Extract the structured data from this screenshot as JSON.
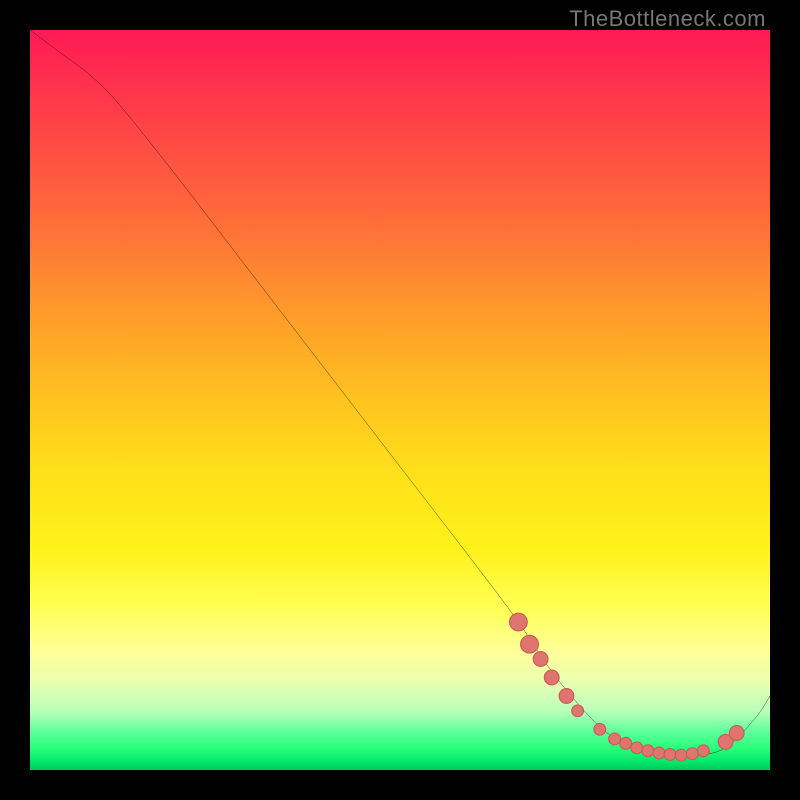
{
  "watermark": "TheBottleneck.com",
  "colors": {
    "page_bg": "#000000",
    "curve": "#000000",
    "dot_fill": "#e0746e",
    "dot_stroke": "#c75b55"
  },
  "chart_data": {
    "type": "line",
    "title": "",
    "xlabel": "",
    "ylabel": "",
    "xlim": [
      0,
      100
    ],
    "ylim": [
      0,
      100
    ],
    "grid": false,
    "legend": false,
    "annotations": [
      "TheBottleneck.com"
    ],
    "series": [
      {
        "name": "curve",
        "x": [
          0,
          4,
          8,
          12,
          20,
          30,
          40,
          50,
          60,
          66,
          70,
          74,
          78,
          82,
          86,
          90,
          94,
          98,
          100
        ],
        "y": [
          100,
          97,
          94,
          90,
          80,
          67,
          54,
          41,
          28,
          20,
          14,
          9,
          5,
          3,
          2,
          2,
          3,
          7,
          10
        ]
      }
    ],
    "markers": [
      {
        "x": 66,
        "y": 20,
        "r": 1.2
      },
      {
        "x": 67.5,
        "y": 17,
        "r": 1.2
      },
      {
        "x": 69,
        "y": 15,
        "r": 1.0
      },
      {
        "x": 70.5,
        "y": 12.5,
        "r": 1.0
      },
      {
        "x": 72.5,
        "y": 10,
        "r": 1.0
      },
      {
        "x": 74,
        "y": 8,
        "r": 0.8
      },
      {
        "x": 77,
        "y": 5.5,
        "r": 0.8
      },
      {
        "x": 79,
        "y": 4.2,
        "r": 0.8
      },
      {
        "x": 80.5,
        "y": 3.6,
        "r": 0.8
      },
      {
        "x": 82,
        "y": 3.0,
        "r": 0.8
      },
      {
        "x": 83.5,
        "y": 2.6,
        "r": 0.8
      },
      {
        "x": 85,
        "y": 2.3,
        "r": 0.8
      },
      {
        "x": 86.5,
        "y": 2.1,
        "r": 0.8
      },
      {
        "x": 88,
        "y": 2.0,
        "r": 0.8
      },
      {
        "x": 89.5,
        "y": 2.2,
        "r": 0.8
      },
      {
        "x": 91,
        "y": 2.6,
        "r": 0.8
      },
      {
        "x": 94,
        "y": 3.8,
        "r": 1.0
      },
      {
        "x": 95.5,
        "y": 5.0,
        "r": 1.0
      }
    ]
  }
}
